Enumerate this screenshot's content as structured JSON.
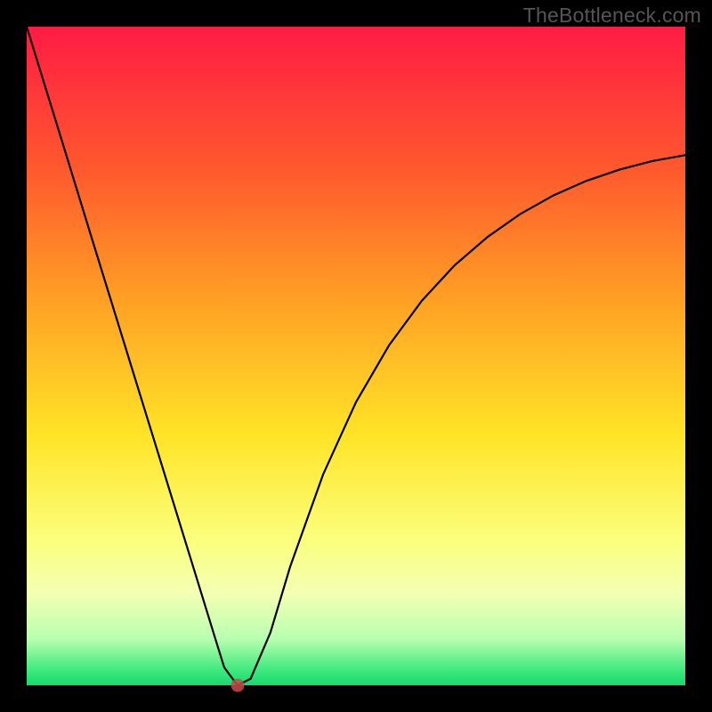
{
  "watermark": "TheBottleneck.com",
  "chart_data": {
    "type": "line",
    "title": "",
    "xlabel": "",
    "ylabel": "",
    "xlim": [
      0,
      1
    ],
    "ylim": [
      0,
      1
    ],
    "series": [
      {
        "name": "curve",
        "x": [
          0.0,
          0.05,
          0.1,
          0.15,
          0.2,
          0.25,
          0.29,
          0.3,
          0.32,
          0.34,
          0.37,
          0.4,
          0.45,
          0.5,
          0.55,
          0.6,
          0.65,
          0.7,
          0.75,
          0.8,
          0.85,
          0.9,
          0.95,
          1.0
        ],
        "values": [
          1.0,
          0.838,
          0.675,
          0.513,
          0.351,
          0.189,
          0.059,
          0.027,
          0.0,
          0.01,
          0.08,
          0.18,
          0.32,
          0.43,
          0.516,
          0.584,
          0.638,
          0.681,
          0.716,
          0.744,
          0.766,
          0.783,
          0.796,
          0.805
        ]
      }
    ],
    "marker": {
      "x": 0.32,
      "y": 0.0
    },
    "colors": {
      "gradient_top": "#ff1b44",
      "gradient_bottom": "#18d86f",
      "curve": "#000000",
      "marker": "#c74a4a",
      "frame": "#000000"
    }
  }
}
